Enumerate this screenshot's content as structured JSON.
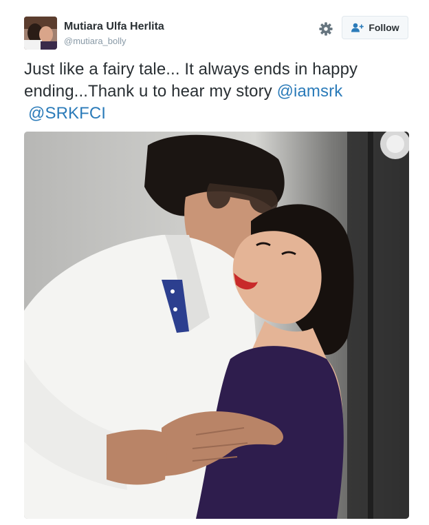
{
  "user": {
    "display_name": "Mutiara Ulfa Herlita",
    "handle": "@mutiara_bolly"
  },
  "actions": {
    "follow_label": "Follow",
    "settings_icon": "gear-icon",
    "follow_icon": "add-person-icon"
  },
  "tweet": {
    "text_line1": "Just like a fairy tale... It always ends in happy",
    "text_line2": "ending...Thank u to hear my story ",
    "mention1": "@iamsrk",
    "mention2": "@SRKFCI"
  },
  "colors": {
    "link": "#2b7bb9",
    "text": "#292f33",
    "muted": "#8899a6"
  }
}
